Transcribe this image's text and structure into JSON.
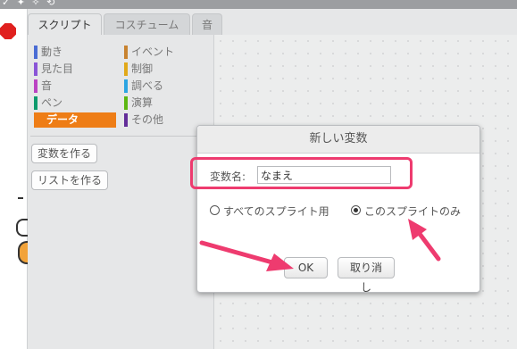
{
  "top_bar": {
    "glyphs": "✓ ✦ ✧ ⟲"
  },
  "tabs": [
    {
      "label": "スクリプト",
      "active": true
    },
    {
      "label": "コスチューム",
      "active": false
    },
    {
      "label": "音",
      "active": false
    }
  ],
  "categories_left": [
    {
      "label": "動き",
      "color": "#4a6cd4"
    },
    {
      "label": "見た目",
      "color": "#8a55d7"
    },
    {
      "label": "音",
      "color": "#bb42c3"
    },
    {
      "label": "ペン",
      "color": "#0e9a6c"
    },
    {
      "label": "データ",
      "color": "#ee7d16",
      "selected": true
    }
  ],
  "categories_right": [
    {
      "label": "イベント",
      "color": "#c88330"
    },
    {
      "label": "制御",
      "color": "#e1a91a"
    },
    {
      "label": "調べる",
      "color": "#2ca5e2"
    },
    {
      "label": "演算",
      "color": "#5cb712"
    },
    {
      "label": "その他",
      "color": "#632d99"
    }
  ],
  "palette_buttons": {
    "make_variable": "変数を作る",
    "make_list": "リストを作る"
  },
  "dialog": {
    "title": "新しい変数",
    "variable_name_label": "変数名:",
    "variable_name_value": "なまえ",
    "radio_all_sprites": "すべてのスプライト用",
    "radio_this_sprite": "このスプライトのみ",
    "selected_scope": "this_sprite",
    "ok_label": "OK",
    "cancel_label": "取り消し"
  },
  "accent_colors": {
    "annotation_pink": "#ee3b6f",
    "data_category": "#ee7d16",
    "stop_red": "#e0201e"
  }
}
